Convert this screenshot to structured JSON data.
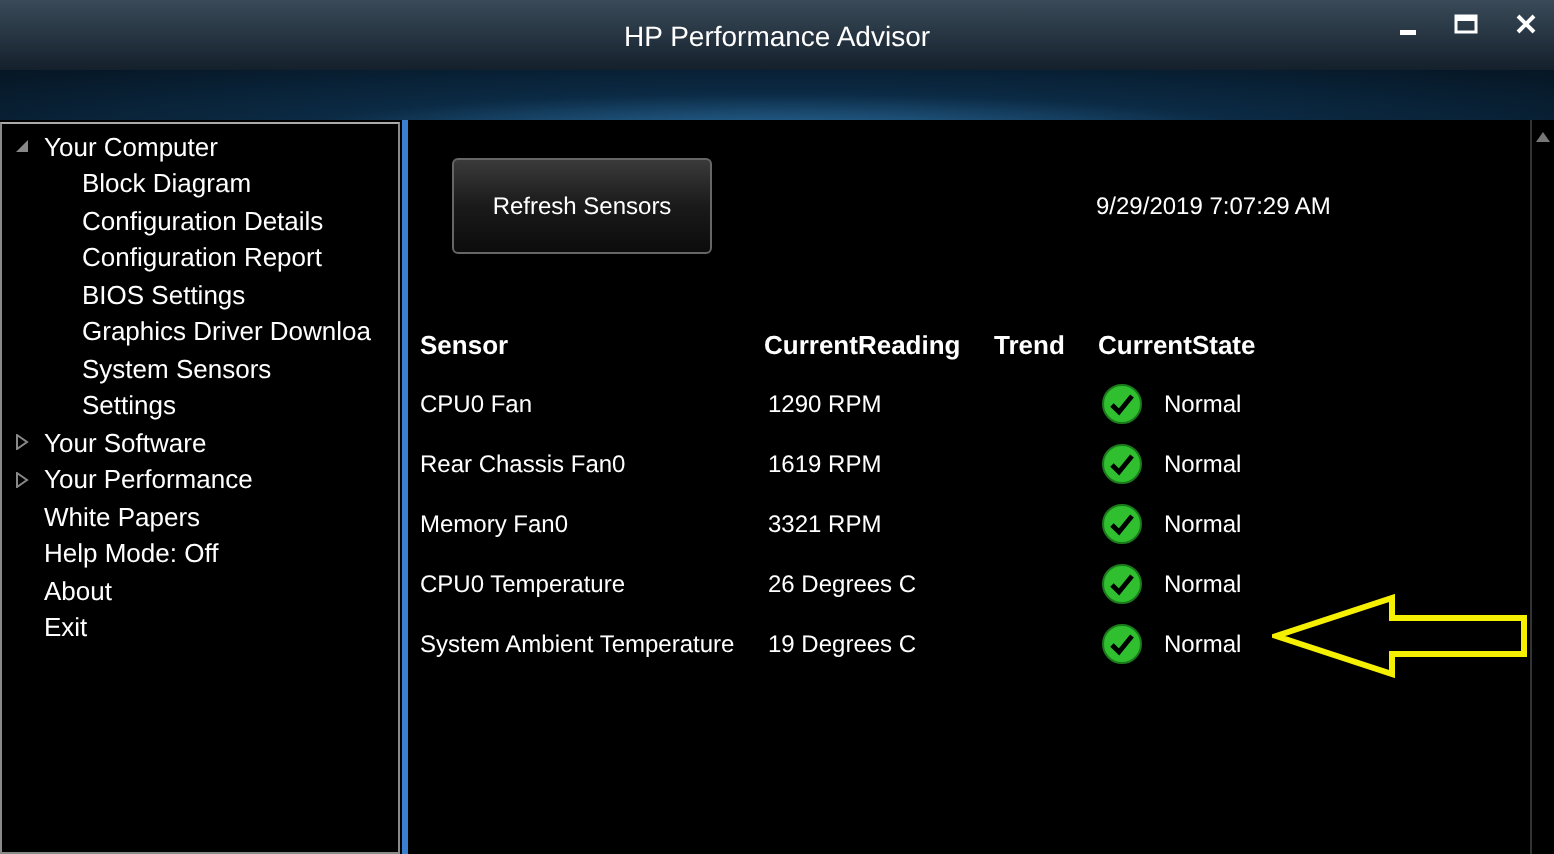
{
  "window": {
    "title": "HP Performance Advisor"
  },
  "sidebar": {
    "items": [
      {
        "label": "Your Computer",
        "expanded": true,
        "children": [
          {
            "label": "Block Diagram"
          },
          {
            "label": "Configuration Details"
          },
          {
            "label": "Configuration Report"
          },
          {
            "label": "BIOS Settings"
          },
          {
            "label": "Graphics Driver Downloa"
          },
          {
            "label": "System Sensors"
          },
          {
            "label": "Settings"
          }
        ]
      },
      {
        "label": "Your Software",
        "expanded": false
      },
      {
        "label": "Your Performance",
        "expanded": false
      },
      {
        "label": "White Papers"
      },
      {
        "label": "Help Mode: Off"
      },
      {
        "label": "About"
      },
      {
        "label": "Exit"
      }
    ]
  },
  "toolbar": {
    "button": "Refresh Sensors",
    "timestamp": "9/29/2019 7:07:29 AM"
  },
  "table": {
    "columns": [
      "Sensor",
      "CurrentReading",
      "Trend",
      "CurrentState"
    ],
    "rows": [
      {
        "sensor": "CPU0 Fan",
        "reading": "1290 RPM",
        "state": "Normal"
      },
      {
        "sensor": "Rear Chassis Fan0",
        "reading": "1619 RPM",
        "state": "Normal"
      },
      {
        "sensor": "Memory Fan0",
        "reading": "3321 RPM",
        "state": "Normal"
      },
      {
        "sensor": "CPU0 Temperature",
        "reading": "26 Degrees C",
        "state": "Normal"
      },
      {
        "sensor": "System Ambient Temperature",
        "reading": "19 Degrees C",
        "state": "Normal"
      }
    ]
  }
}
